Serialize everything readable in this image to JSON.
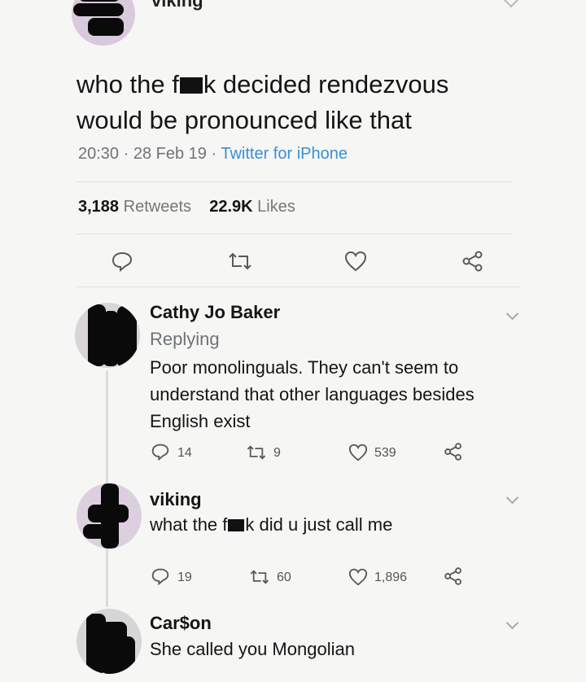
{
  "tweet": {
    "author": "viking",
    "text_part1": "who the f",
    "text_part2": "k decided rendezvous",
    "text_line2": "would be pronounced like that",
    "time": "20:30",
    "date": "28 Feb 19",
    "source": "Twitter for iPhone",
    "retweets_count": "3,188",
    "retweets_label": "Retweets",
    "likes_count": "22.9K",
    "likes_label": "Likes"
  },
  "replies": [
    {
      "name": "Cathy Jo Baker",
      "replying": "Replying",
      "text": "Poor monolinguals. They can't seem to understand that other languages besides English exist",
      "reply_count": "14",
      "retweet_count": "9",
      "like_count": "539"
    },
    {
      "name": "viking",
      "text_part1": "what the f",
      "text_part2": "k did u just call me",
      "reply_count": "19",
      "retweet_count": "60",
      "like_count": "1,896"
    },
    {
      "name": "Car$on",
      "text": "She called you Mongolian"
    }
  ],
  "icons": [
    "reply-icon",
    "retweet-icon",
    "like-icon",
    "share-icon",
    "chevron-down-icon"
  ]
}
